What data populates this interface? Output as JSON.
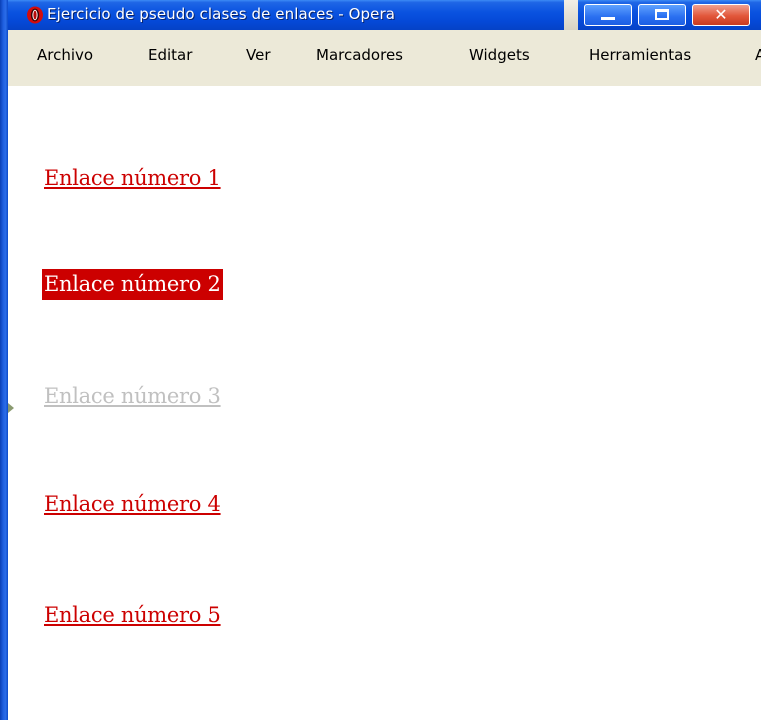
{
  "window": {
    "title": "Ejercicio de pseudo clases de enlaces - Opera",
    "icon": "opera-icon",
    "controls": {
      "minimize": "minimize-icon",
      "maximize": "maximize-icon",
      "close": "close-icon",
      "close_glyph": "✕"
    }
  },
  "menu": {
    "items": [
      {
        "label": "Archivo"
      },
      {
        "label": "Editar"
      },
      {
        "label": "Ver"
      },
      {
        "label": "Marcadores"
      },
      {
        "label": "Widgets"
      },
      {
        "label": "Herramientas"
      },
      {
        "label": "A"
      }
    ]
  },
  "links": [
    {
      "text": "Enlace número 1",
      "state": "link"
    },
    {
      "text": "Enlace número 2",
      "state": "active"
    },
    {
      "text": "Enlace número 3",
      "state": "visited"
    },
    {
      "text": "Enlace número 4",
      "state": "link"
    },
    {
      "text": "Enlace número 5",
      "state": "link"
    }
  ],
  "colors": {
    "link": "#cc0000",
    "active_background": "#cc0000",
    "active_text": "#ffffff",
    "visited": "#c0c0c0",
    "titlebar": "#0549d8",
    "menubar": "#ece9d8"
  }
}
